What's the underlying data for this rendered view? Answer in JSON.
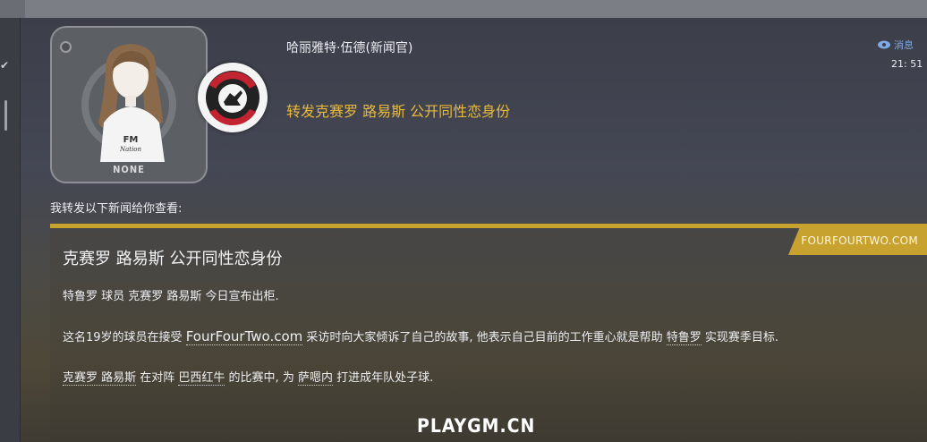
{
  "sender": {
    "name": "哈丽雅特·伍德(新闻官)"
  },
  "message": {
    "subject": "转发克赛罗 路易斯 公开同性恋身份",
    "tag": "消息",
    "time": "21: 51"
  },
  "avatar": {
    "caption": "NONE"
  },
  "intro": "我转发以下新闻给你查看:",
  "article": {
    "source": "FOURFOURTWO.COM",
    "headline": "克赛罗 路易斯 公开同性恋身份",
    "p1": {
      "player": "特鲁罗 球员 克赛罗 路易斯",
      "rest": " 今日宣布出柜."
    },
    "p2": {
      "before": "这名19岁的球员在接受 ",
      "site": "FourFourTwo.com",
      "middle": " 采访时向大家倾诉了自己的故事, 他表示自己目前的工作重心就是帮助 ",
      "club": "特鲁罗",
      "after": " 实现赛季目标."
    },
    "p3": {
      "player": "克赛罗 路易斯",
      "t1": " 在对阵 ",
      "opponent": "巴西红牛",
      "t2": " 的比赛中, 为 ",
      "team": "萨嗯内",
      "t3": " 打进成年队处子球."
    }
  },
  "watermark": "PLAYGM.CN",
  "colors": {
    "accent_gold": "#c8a22f",
    "subject_text": "#e7b93a",
    "tag_blue": "#7ea8e6"
  }
}
